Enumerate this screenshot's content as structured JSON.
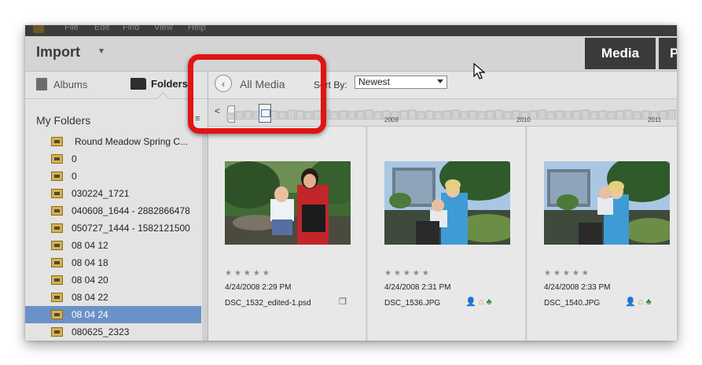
{
  "menu": [
    "File",
    "Edit",
    "Find",
    "View",
    "Help"
  ],
  "header": {
    "import_label": "Import",
    "media_tab": "Media",
    "next_tab": "P"
  },
  "sidebar": {
    "tabs": {
      "albums": "Albums",
      "folders": "Folders"
    },
    "section_title": "My Folders",
    "folders": [
      "Round Meadow Spring C...",
      "0",
      "0",
      "030224_1721",
      "040608_1644 - 2882866478",
      "050727_1444 - 1582121500",
      "08 04 12",
      "08 04 18",
      "08 04 20",
      "08 04 22",
      "08 04 24",
      "080625_2323"
    ],
    "selected_index": 10
  },
  "toolbar": {
    "back_label": "All Media",
    "sort_label": "Sort By:",
    "sort_value": "Newest"
  },
  "timeline": {
    "years": [
      "2009",
      "2010",
      "2011"
    ]
  },
  "photos": [
    {
      "date": "4/24/2008 2:29 PM",
      "filename": "DSC_1532_edited-1.psd",
      "rating": "★★★★★",
      "badges": [
        "version-set-icon"
      ]
    },
    {
      "date": "4/24/2008 2:31 PM",
      "filename": "DSC_1536.JPG",
      "rating": "★★★★★",
      "badges": [
        "person-icon",
        "house-icon",
        "palm-icon"
      ]
    },
    {
      "date": "4/24/2008 2:33 PM",
      "filename": "DSC_1540.JPG",
      "rating": "★★★★★",
      "badges": [
        "person-icon",
        "house-icon",
        "palm-icon"
      ]
    }
  ],
  "colors": {
    "selection": "#6b91c7",
    "highlight": "#e01414",
    "media_tab": "#3a3a3a"
  }
}
